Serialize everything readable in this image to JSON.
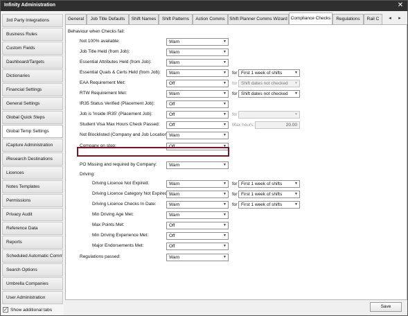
{
  "window": {
    "title": "Infinity Administration",
    "close_icon": "close-icon"
  },
  "sidebar": {
    "items": [
      {
        "label": "3rd Party Integrations"
      },
      {
        "label": "Business Rules"
      },
      {
        "label": "Custom Fields"
      },
      {
        "label": "Dashboard/Targets"
      },
      {
        "label": "Dictionaries"
      },
      {
        "label": "Financial Settings"
      },
      {
        "label": "General Settings"
      },
      {
        "label": "Global Quick Steps"
      },
      {
        "label": "Global Temp Settings",
        "active": true
      },
      {
        "label": "iCapture Administration"
      },
      {
        "label": "iResearch Destinations"
      },
      {
        "label": "Licences"
      },
      {
        "label": "Notes Templates"
      },
      {
        "label": "Permissions"
      },
      {
        "label": "Privacy Audit"
      },
      {
        "label": "Reference Data"
      },
      {
        "label": "Reports"
      },
      {
        "label": "Scheduled Automatic Comms"
      },
      {
        "label": "Search Options"
      },
      {
        "label": "Umbrella Companies"
      },
      {
        "label": "User Administration"
      }
    ],
    "show_tabs_label": "Show additional tabs",
    "show_tabs_checked": true
  },
  "tabs": [
    {
      "label": "General"
    },
    {
      "label": "Job Title Defaults"
    },
    {
      "label": "Shift Names"
    },
    {
      "label": "Shift Patterns"
    },
    {
      "label": "Action Comms"
    },
    {
      "label": "Shift Planner Comms Wizard"
    },
    {
      "label": "Compliance Checks",
      "active": true
    },
    {
      "label": "Regulations"
    },
    {
      "label": "Rail C"
    }
  ],
  "tab_nav": {
    "prev": "◂",
    "next": "▸"
  },
  "panel": {
    "heading": "Behaviour when Checks fail:",
    "rows": [
      {
        "label": "Not 100% available:",
        "value": "Warn"
      },
      {
        "label": "Job Title Held (from Job):",
        "value": "Warn"
      },
      {
        "label": "Essential Attributes Held (from Job):",
        "value": "Warn"
      },
      {
        "label": "Essential Quals & Certs Held (from Job):",
        "value": "Warn",
        "for_label": "for",
        "for_value": "First 1 week of shifts"
      },
      {
        "label": "EAA Requirement Met:",
        "value": "Off",
        "for_label": "for",
        "for_value": "Shift dates not checked",
        "for_disabled": true
      },
      {
        "label": "RTW Requirement Met:",
        "value": "Warn",
        "for_label": "for",
        "for_value": "Shift dates not checked"
      },
      {
        "label": "IR35 Status Verified (Placement Job):",
        "value": "Off"
      },
      {
        "label": "Job is 'Inside IR35' (Placement Job):",
        "value": "Off",
        "for_label": "for",
        "for_value": "",
        "for_disabled": true
      },
      {
        "label": "Student Visa Max Hours Check Passed:",
        "value": "Off",
        "max_hours_label": "Max hours:",
        "max_hours_value": "20.00"
      },
      {
        "label": "Not Blocklisted (Company and Job Location):",
        "value": "Warn"
      },
      {
        "label": "Company on stop:",
        "value": "Off"
      },
      {
        "label": "PO Missing and required by Company:",
        "value": "Warn"
      }
    ],
    "driving_heading": "Driving:",
    "driving_rows": [
      {
        "label": "Driving Licence Not Expired:",
        "value": "Warn",
        "for_label": "for",
        "for_value": "First 1 week of shifts"
      },
      {
        "label": "Driving Licence Category Not Expired:",
        "value": "Warn",
        "for_label": "for",
        "for_value": "First 1 week of shifts"
      },
      {
        "label": "Driving Licence Checks In Date:",
        "value": "Warn",
        "for_label": "for",
        "for_value": "First 1 week of shifts"
      },
      {
        "label": "Min Driving Age Met:",
        "value": "Warn"
      },
      {
        "label": "Max Points Met:",
        "value": "Off"
      },
      {
        "label": "Min Driving Experience Met:",
        "value": "Off"
      },
      {
        "label": "Major Endorsements Met:",
        "value": "Off"
      }
    ],
    "regulations": {
      "label": "Regulations passed:",
      "value": "Warn"
    }
  },
  "footer": {
    "save_label": "Save"
  },
  "colors": {
    "highlight": "#7d1424",
    "titlebar": "#2f2f2f"
  }
}
